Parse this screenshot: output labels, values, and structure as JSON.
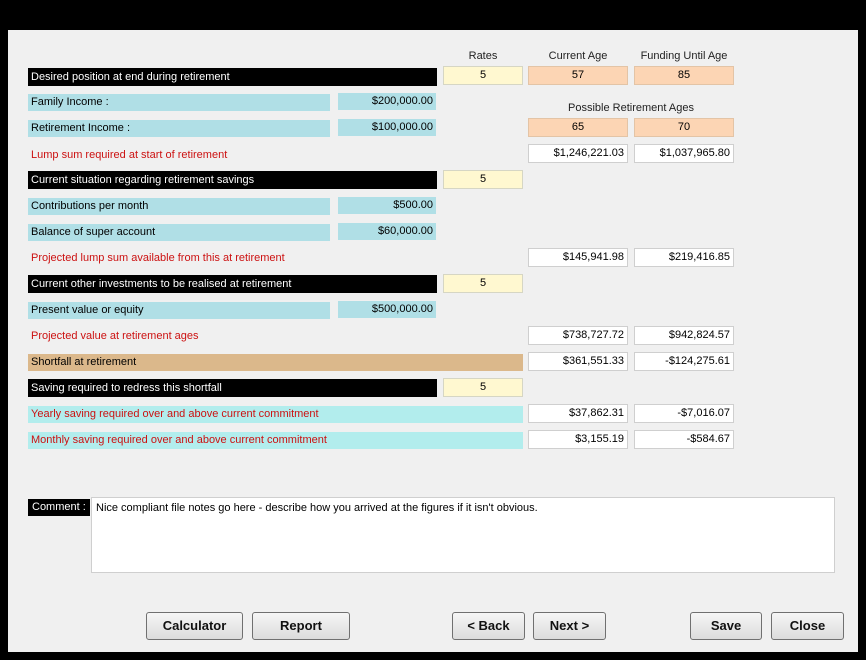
{
  "headers": {
    "rates": "Rates",
    "current_age": "Current Age",
    "funding_until_age": "Funding Until Age",
    "possible_retirement_ages": "Possible Retirement Ages"
  },
  "desired": {
    "title": "Desired position at end during retirement",
    "rate": "5",
    "current_age": "57",
    "funding_until_age": "85",
    "family_income_label": "Family Income :",
    "family_income": "$200,000.00",
    "retirement_income_label": "Retirement Income :",
    "retirement_income": "$100,000.00",
    "retirement_age_1": "65",
    "retirement_age_2": "70",
    "lump_sum_label": "Lump sum required at start of retirement",
    "lump_sum_1": "$1,246,221.03",
    "lump_sum_2": "$1,037,965.80"
  },
  "current": {
    "title": "Current situation regarding retirement savings",
    "rate": "5",
    "contributions_label": "Contributions per month",
    "contributions": "$500.00",
    "balance_label": "Balance of super account",
    "balance": "$60,000.00",
    "projected_label": "Projected lump sum available from this at retirement",
    "projected_1": "$145,941.98",
    "projected_2": "$219,416.85"
  },
  "other": {
    "title": "Current other investments to be realised at retirement",
    "rate": "5",
    "present_value_label": "Present value or equity",
    "present_value": "$500,000.00",
    "projected_label": "Projected value at retirement ages",
    "projected_1": "$738,727.72",
    "projected_2": "$942,824.57"
  },
  "shortfall": {
    "label": "Shortfall at retirement",
    "value_1": "$361,551.33",
    "value_2": "-$124,275.61"
  },
  "saving": {
    "title": "Saving required to redress this shortfall",
    "rate": "5",
    "yearly_label": "Yearly saving required over and above current commitment",
    "yearly_1": "$37,862.31",
    "yearly_2": "-$7,016.07",
    "monthly_label": "Monthly saving required over and above current commitment",
    "monthly_1": "$3,155.19",
    "monthly_2": "-$584.67"
  },
  "comment": {
    "label": "Comment :",
    "text": "Nice compliant file notes go here - describe how you arrived at the figures if it isn't obvious."
  },
  "buttons": {
    "calculator": "Calculator",
    "report": "Report",
    "back": "< Back",
    "next": "Next >",
    "save": "Save",
    "close": "Close"
  },
  "colors": {
    "section_bar": "#000000",
    "label_fill": "#b0dfe6",
    "rate_fill": "#fff8d0",
    "age_fill": "#fcd5b4",
    "shortfall_fill": "#dbb88b",
    "warning_text": "#cc1111"
  }
}
